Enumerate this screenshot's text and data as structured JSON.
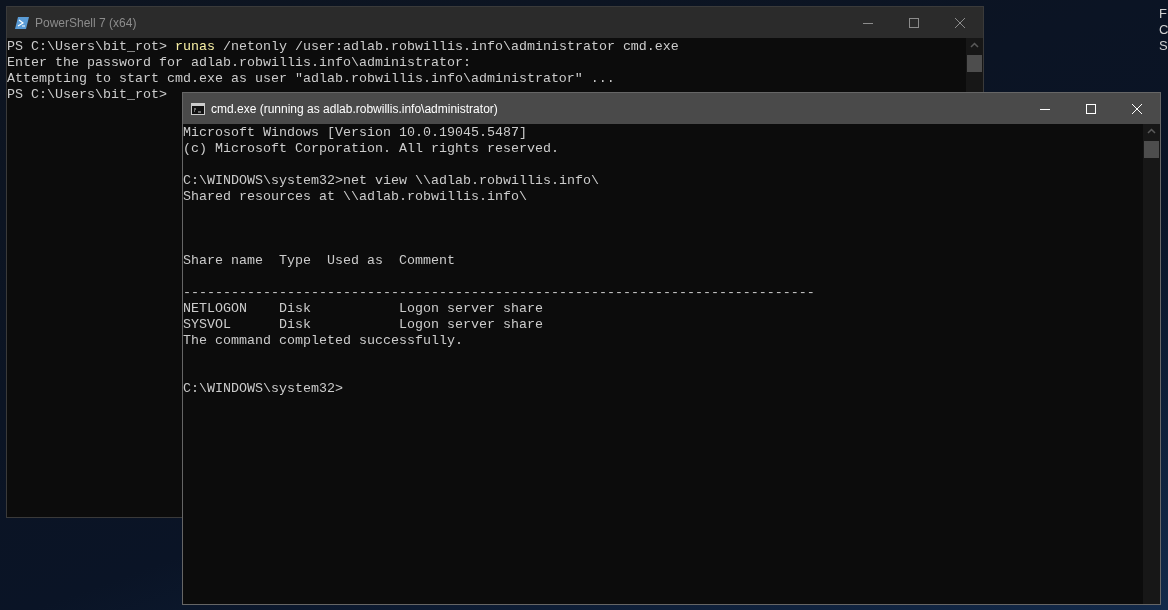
{
  "desktop": {
    "edge_text": [
      "F",
      "C",
      "S"
    ]
  },
  "powershell": {
    "title": "PowerShell 7 (x64)",
    "active": false,
    "lines": [
      {
        "kind": "command",
        "prompt": "PS C:\\Users\\bit_rot> ",
        "command": "runas",
        "arguments": " /netonly /user:adlab.robwillis.info\\administrator cmd.exe"
      },
      {
        "kind": "output",
        "text": "Enter the password for adlab.robwillis.info\\administrator:"
      },
      {
        "kind": "output",
        "text": "Attempting to start cmd.exe as user \"adlab.robwillis.info\\administrator\" ..."
      },
      {
        "kind": "prompt",
        "text": "PS C:\\Users\\bit_rot>"
      }
    ]
  },
  "cmd": {
    "title": "cmd.exe (running as adlab.robwillis.info\\administrator)",
    "active": true,
    "lines": [
      {
        "kind": "output",
        "text": "Microsoft Windows [Version 10.0.19045.5487]"
      },
      {
        "kind": "output",
        "text": "(c) Microsoft Corporation. All rights reserved."
      },
      {
        "kind": "blank"
      },
      {
        "kind": "output",
        "text": "C:\\WINDOWS\\system32>net view \\\\adlab.robwillis.info\\"
      },
      {
        "kind": "output",
        "text": "Shared resources at \\\\adlab.robwillis.info\\"
      },
      {
        "kind": "blank"
      },
      {
        "kind": "blank"
      },
      {
        "kind": "blank"
      },
      {
        "kind": "output",
        "text": "Share name  Type  Used as  Comment"
      },
      {
        "kind": "blank"
      },
      {
        "kind": "output",
        "text": "-------------------------------------------------------------------------------"
      },
      {
        "kind": "output",
        "text": "NETLOGON    Disk           Logon server share"
      },
      {
        "kind": "output",
        "text": "SYSVOL      Disk           Logon server share"
      },
      {
        "kind": "output",
        "text": "The command completed successfully."
      },
      {
        "kind": "blank"
      },
      {
        "kind": "blank"
      },
      {
        "kind": "output",
        "text": "C:\\WINDOWS\\system32>"
      }
    ]
  }
}
